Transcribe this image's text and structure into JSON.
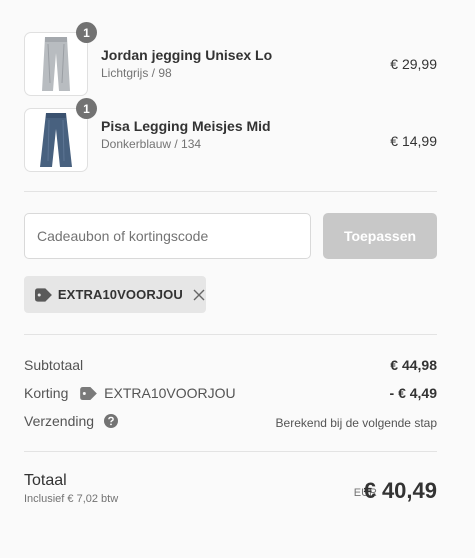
{
  "items": [
    {
      "quantity": "1",
      "name": "Jordan jegging Unisex Lo",
      "variant": "Lichtgrijs / 98",
      "price": "€ 29,99",
      "image_icon": "grey-jeans-icon",
      "image_color": "#b8bcc0"
    },
    {
      "quantity": "1",
      "name": "Pisa Legging Meisjes Mid",
      "variant": "Donkerblauw / 134",
      "price": "€ 14,99",
      "image_icon": "blue-jeans-icon",
      "image_color": "#48617f"
    }
  ],
  "discount": {
    "placeholder": "Cadeaubon of kortingscode",
    "apply_label": "Toepassen",
    "applied_code": "EXTRA10VOORJOU"
  },
  "summary": {
    "subtotal_label": "Subtotaal",
    "subtotal_value": "€ 44,98",
    "discount_label": "Korting",
    "discount_code": "EXTRA10VOORJOU",
    "discount_value": "- € 4,49",
    "shipping_label": "Verzending",
    "shipping_note": "Berekend bij de volgende stap"
  },
  "total": {
    "label": "Totaal",
    "tax_note": "Inclusief € 7,02 btw",
    "currency": "EUR",
    "value": "€ 40,49"
  },
  "colors": {
    "button_disabled": "#c8c8c8",
    "badge": "#727272",
    "chip_bg": "#e6e6e6"
  }
}
